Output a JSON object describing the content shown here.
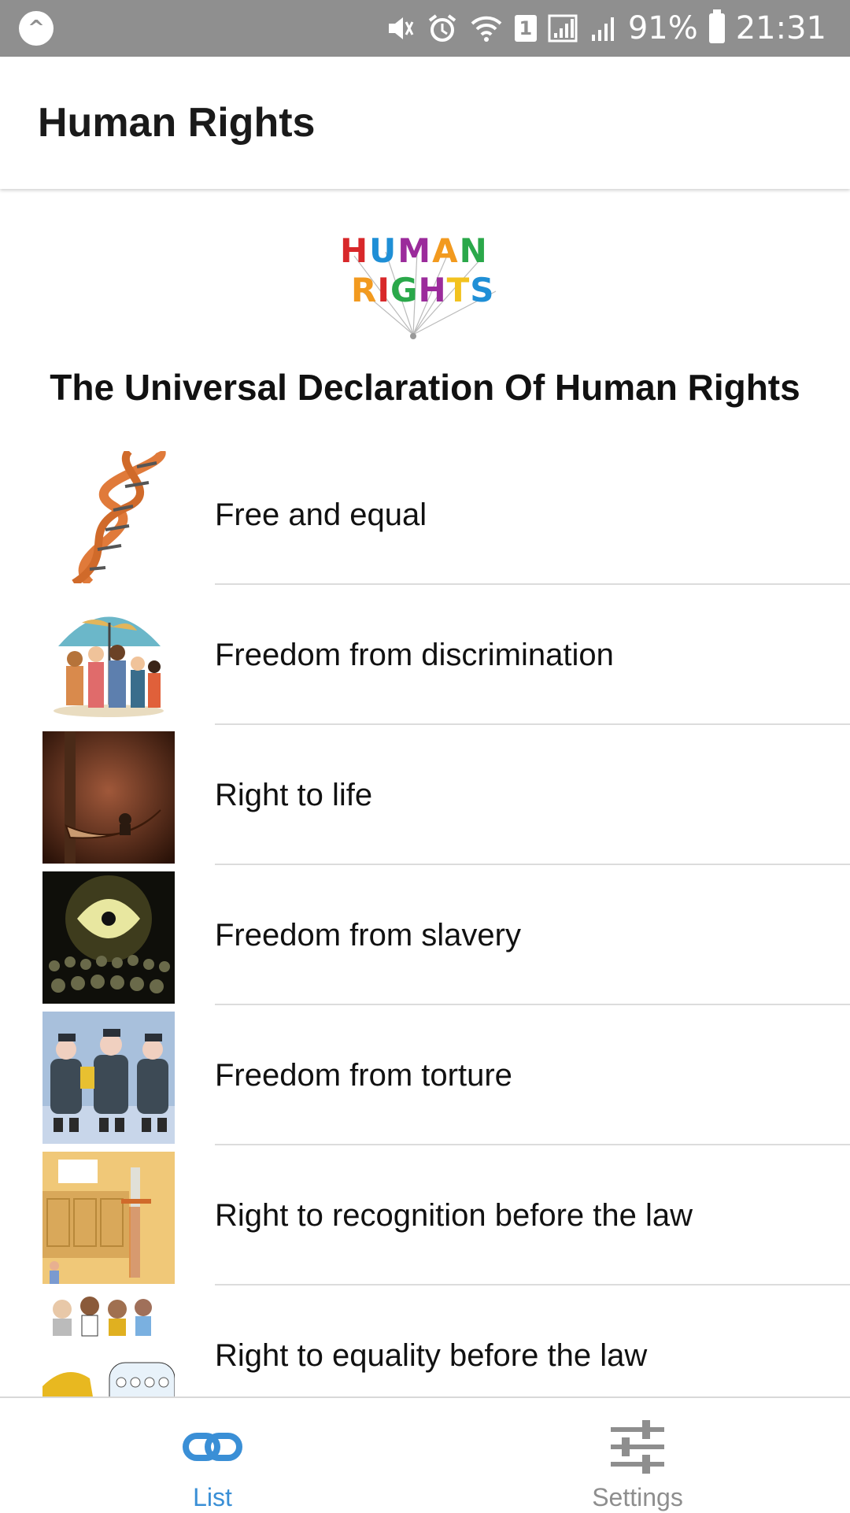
{
  "status_bar": {
    "battery": "91%",
    "time": "21:31",
    "sim": "1",
    "icons": [
      "app-icon",
      "mute-icon",
      "alarm-icon",
      "wifi-icon",
      "sim-icon",
      "signal-icon",
      "signal-icon",
      "battery-icon"
    ]
  },
  "header": {
    "title": "Human Rights"
  },
  "logo": {
    "line1": "HUMAN",
    "line2": "RIGHTS"
  },
  "subtitle": "The Universal Declaration Of Human Rights",
  "list": {
    "items": [
      {
        "label": "Free and equal",
        "icon": "dna-illustration"
      },
      {
        "label": "Freedom from discrimination",
        "icon": "umbrella-family-illustration"
      },
      {
        "label": "Right to life",
        "icon": "scythe-illustration"
      },
      {
        "label": "Freedom from slavery",
        "icon": "crowd-light-illustration"
      },
      {
        "label": "Freedom from torture",
        "icon": "soldiers-illustration"
      },
      {
        "label": "Right to recognition before the law",
        "icon": "courtroom-illustration"
      },
      {
        "label": "Right to equality before the law",
        "icon": "people-illustration"
      }
    ]
  },
  "tabs": [
    {
      "label": "List",
      "icon": "link-icon",
      "active": true
    },
    {
      "label": "Settings",
      "icon": "sliders-icon",
      "active": false
    }
  ],
  "colors": {
    "accent": "#3a8fd6",
    "status_bar": "#8f8f8f",
    "inactive_tab": "#8e8e8e"
  }
}
